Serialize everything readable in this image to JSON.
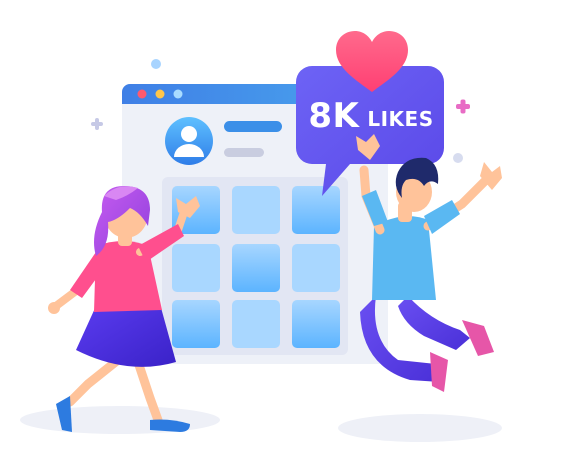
{
  "likes_badge": {
    "count": "8K",
    "label": "LIKES"
  },
  "colors": {
    "browser_bar": "#3b8fe8",
    "window_bg": "#eef1f8",
    "tile_light": "#b7dcff",
    "tile_mid": "#6ec0ff",
    "speech_bubble": "#6a5cf0",
    "heart": "#ff4d7e",
    "accent_plus": "#e86cc5",
    "girl_shirt": "#ff4f8e",
    "girl_skirt": "#4a2fe0",
    "girl_hair": "#b455e8",
    "boy_shirt": "#5ab8f2",
    "boy_pants": "#5a3fe6",
    "boy_shoes": "#e656a8"
  },
  "icons": [
    "heart-icon",
    "avatar-icon",
    "plus-icon",
    "dot-icon"
  ]
}
